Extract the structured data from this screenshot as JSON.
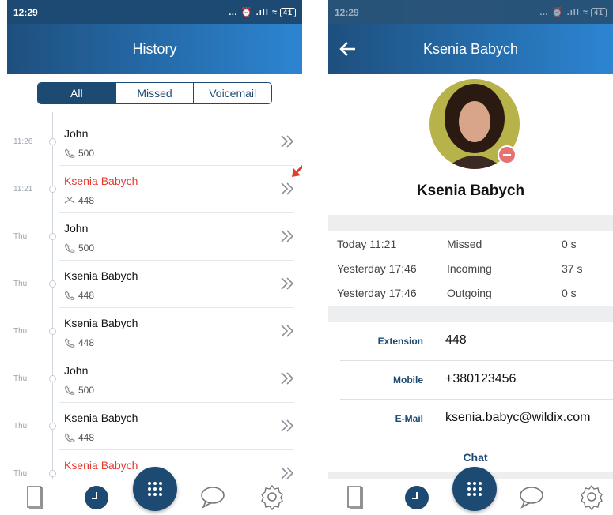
{
  "left": {
    "status": {
      "time": "12:29",
      "icons": "… ⏰ .ıll ≈",
      "battery": "41"
    },
    "title": "History",
    "filters": [
      "All",
      "Missed",
      "Voicemail"
    ],
    "rows": [
      {
        "time": "11:26",
        "name": "John",
        "number": "500",
        "missed": false
      },
      {
        "time": "11:21",
        "name": "Ksenia Babych",
        "number": "448",
        "missed": true
      },
      {
        "time": "Thu",
        "name": "John",
        "number": "500",
        "missed": false
      },
      {
        "time": "Thu",
        "name": "Ksenia Babych",
        "number": "448",
        "missed": false
      },
      {
        "time": "Thu",
        "name": "Ksenia Babych",
        "number": "448",
        "missed": false
      },
      {
        "time": "Thu",
        "name": "John",
        "number": "500",
        "missed": false
      },
      {
        "time": "Thu",
        "name": "Ksenia Babych",
        "number": "448",
        "missed": false
      },
      {
        "time": "Thu",
        "name": "Ksenia Babych",
        "number": "",
        "missed": true
      }
    ]
  },
  "right": {
    "status": {
      "time": "12:29",
      "icons": "… ⏰ .ıll ≈",
      "battery": "41"
    },
    "title": "Ksenia Babych",
    "contact_name": "Ksenia Babych",
    "calls": [
      {
        "when": "Today 11:21",
        "type": "Missed",
        "duration": "0 s"
      },
      {
        "when": "Yesterday 17:46",
        "type": "Incoming",
        "duration": "37 s"
      },
      {
        "when": "Yesterday 17:46",
        "type": "Outgoing",
        "duration": "0 s"
      }
    ],
    "details": [
      {
        "label": "Extension",
        "value": "448"
      },
      {
        "label": "Mobile",
        "value": "+380123456"
      },
      {
        "label": "E-Mail",
        "value": "ksenia.babyc@wildix.com"
      }
    ],
    "chat_label": "Chat"
  },
  "colors": {
    "primary": "#1d4a72",
    "accent": "#2c85d2",
    "missed": "#e5392f",
    "annotation_arrow": "#e53a2e"
  }
}
